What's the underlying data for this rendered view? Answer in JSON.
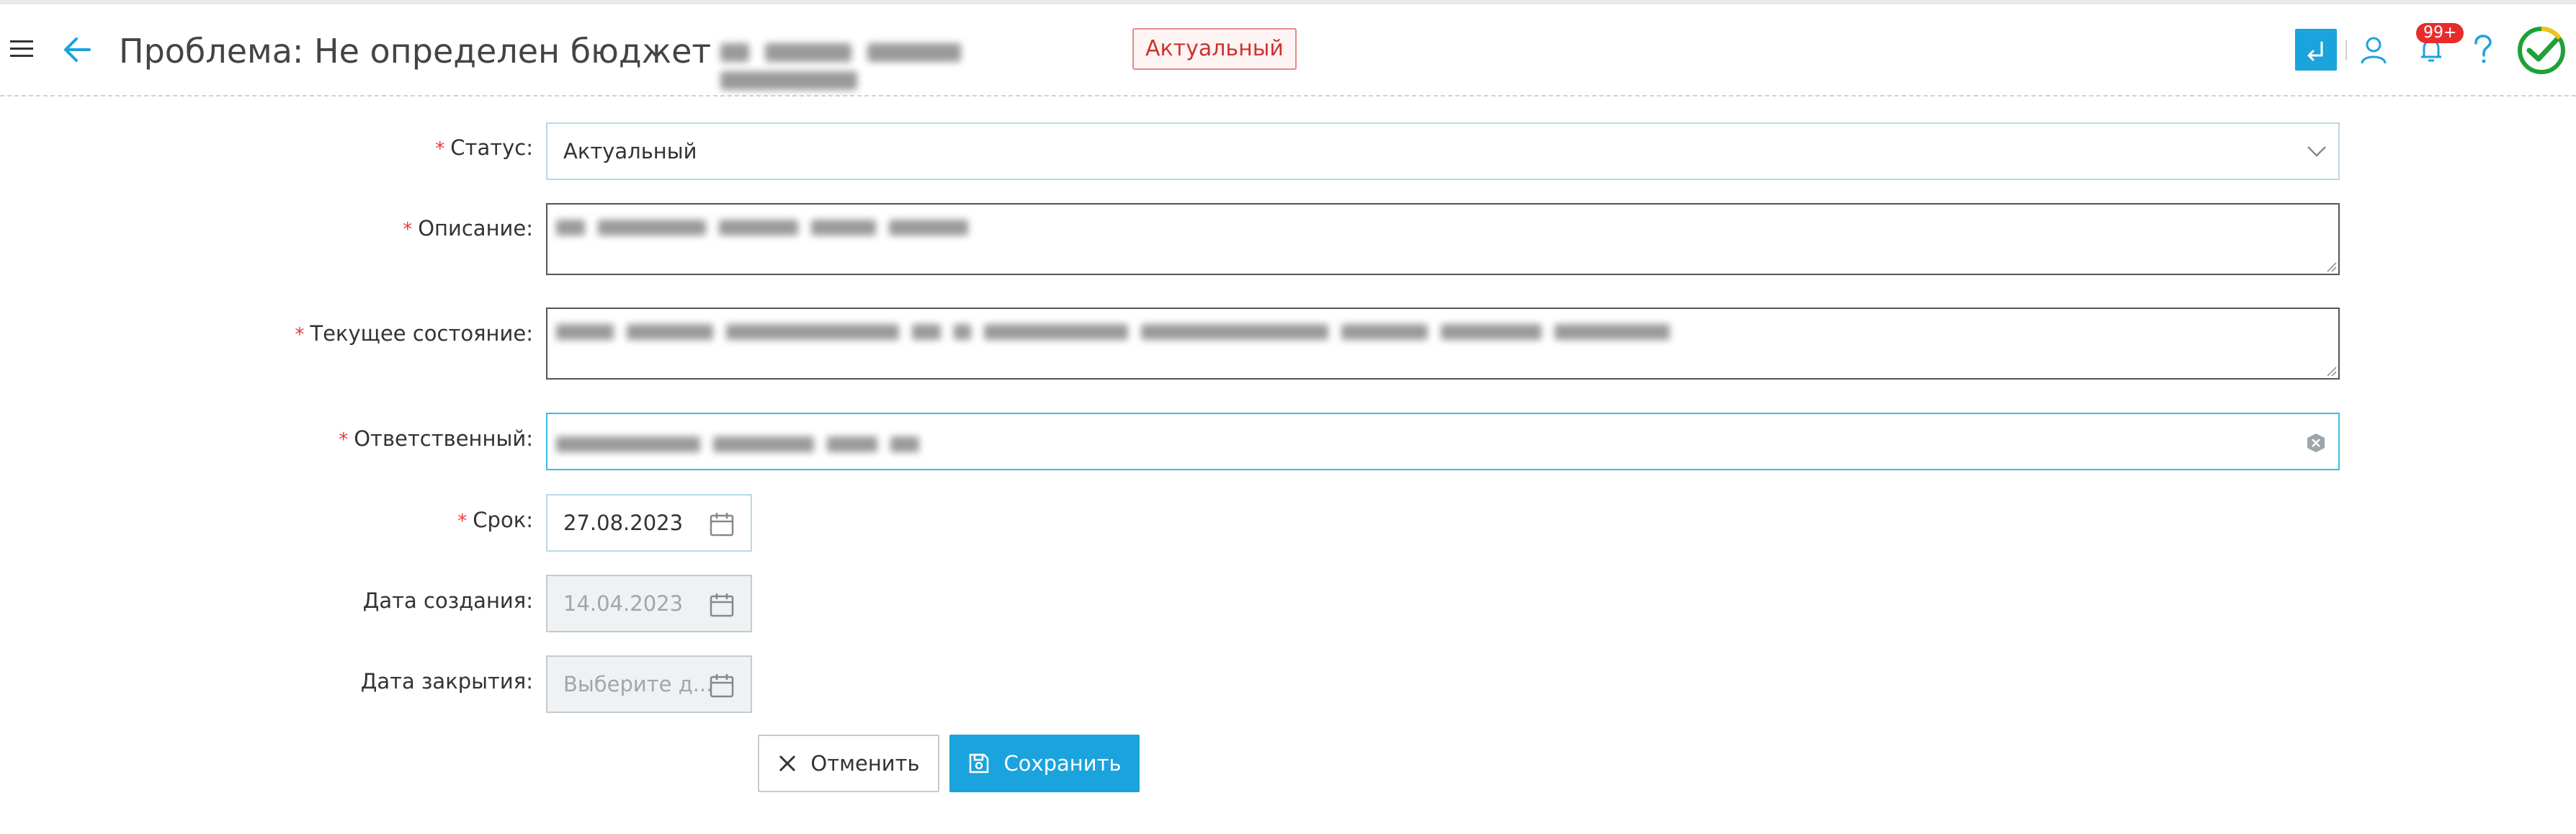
{
  "header": {
    "title": "Проблема: Не определен бюджет",
    "status_badge": "Актуальный",
    "notifications_count": "99+",
    "icons": [
      "hamburger-icon",
      "back-arrow-icon",
      "return-icon",
      "user-icon",
      "bell-icon",
      "help-icon",
      "sber-logo"
    ]
  },
  "form": {
    "status": {
      "label": "Статус",
      "required": true,
      "value": "Актуальный"
    },
    "description": {
      "label": "Описание",
      "required": true
    },
    "current_state": {
      "label": "Текущее состояние",
      "required": true
    },
    "responsible": {
      "label": "Ответственный",
      "required": true
    },
    "deadline": {
      "label": "Срок",
      "required": true,
      "value": "27.08.2023"
    },
    "created_date": {
      "label": "Дата создания",
      "required": false,
      "value": "14.04.2023"
    },
    "closed_date": {
      "label": "Дата закрытия",
      "required": false,
      "placeholder": "Выберите д..."
    },
    "required_mark": "*",
    "label_suffix": ":"
  },
  "actions": {
    "cancel_label": "Отменить",
    "save_label": "Сохранить"
  },
  "colors": {
    "accent": "#1aa3dc",
    "required": "#e83a3a",
    "badge_text": "#d0312d",
    "notification": "#e82c2c"
  }
}
